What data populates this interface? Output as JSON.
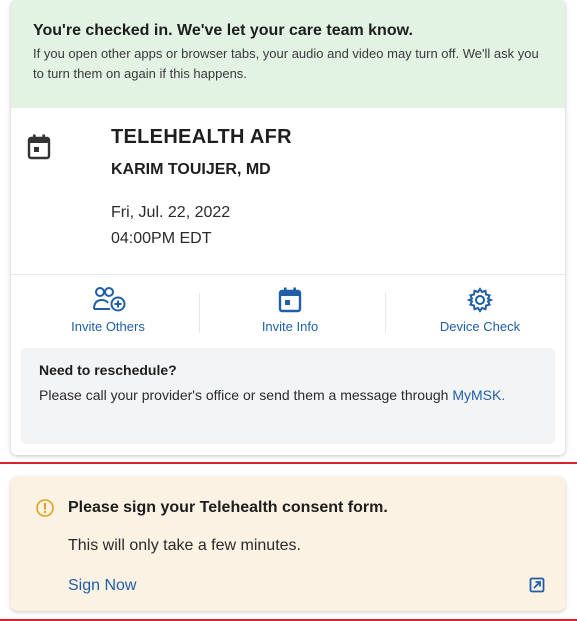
{
  "checkin": {
    "title": "You're checked in. We've let your care team know.",
    "message": "If you open other apps or browser tabs, your audio and video may turn off. We'll ask you to turn them on again if this happens."
  },
  "appointment": {
    "icon": "calendar-icon",
    "type": "TELEHEALTH AFR",
    "provider": "KARIM TOUIJER, MD",
    "date": "Fri, Jul. 22, 2022",
    "time": "04:00PM EDT"
  },
  "actions": [
    {
      "label": "Invite Others",
      "icon": "invite-people-icon"
    },
    {
      "label": "Invite Info",
      "icon": "calendar-icon"
    },
    {
      "label": "Device Check",
      "icon": "gear-icon"
    }
  ],
  "reschedule": {
    "title": "Need to reschedule?",
    "text": "Please call your provider's office or send them a message through ",
    "link": "MyMSK."
  },
  "consent": {
    "icon": "warning-icon",
    "title": "Please sign your Telehealth consent form.",
    "subtitle": "This will only take a few minutes.",
    "action": "Sign Now",
    "external_icon": "external-link-icon"
  },
  "colors": {
    "banner_bg": "#e2f3e4",
    "link": "#1f5fa8",
    "consent_bg": "#fbf2e4",
    "warning": "#e0a21a",
    "highlight_border": "#d6242f"
  }
}
